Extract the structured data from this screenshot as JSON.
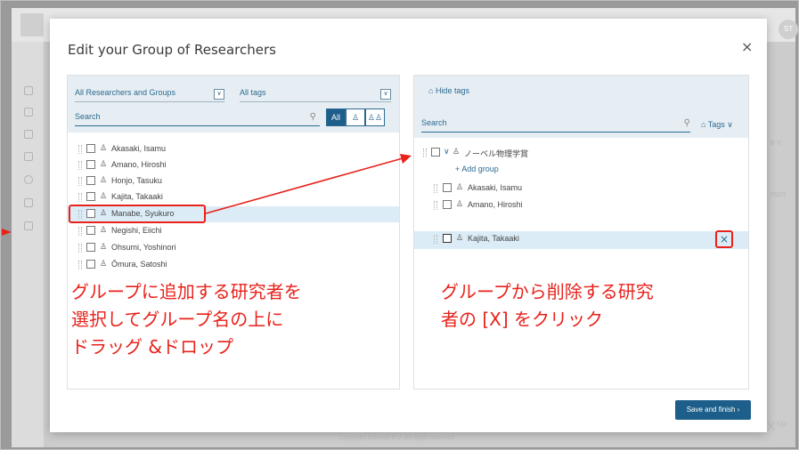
{
  "background": {
    "avatar_initials": "ST",
    "right_hint_1": "e v",
    "right_hint_2": "rsch",
    "footer": "Copyright Elsevier B.V. All rights reserved.",
    "elx": "LX™"
  },
  "modal": {
    "title": "Edit your Group of Researchers",
    "close_label": "×",
    "save_label": "Save and finish  ›"
  },
  "left_panel": {
    "filter_researchers": "All Researchers and Groups",
    "filter_tags": "All tags",
    "search_placeholder": "Search",
    "segments": [
      "All",
      "♙",
      "♙♙"
    ],
    "rows": [
      {
        "name": "Akasaki, Isamu"
      },
      {
        "name": "Amano, Hiroshi"
      },
      {
        "name": "Honjo, Tasuku"
      },
      {
        "name": "Kajita, Takaaki"
      },
      {
        "name": "Manabe, Syukuro"
      },
      {
        "name": "Negishi, Eiichi"
      },
      {
        "name": "Ohsumi, Yoshinori"
      },
      {
        "name": "Ōmura, Satoshi"
      }
    ]
  },
  "right_panel": {
    "hide_tags": "Hide tags",
    "search_placeholder": "Search",
    "tags_label": "Tags ∨",
    "group_name": "ノーベル物理学賞",
    "add_group": "+ Add group",
    "members": [
      {
        "name": "Akasaki, Isamu"
      },
      {
        "name": "Amano, Hiroshi"
      },
      {
        "name": "Kajita, Takaaki"
      }
    ],
    "remove_label": "×"
  },
  "annotations": {
    "left": [
      "グループに追加する研究者を",
      "選択してグループ名の上に",
      "ドラッグ &ドロップ"
    ],
    "right": [
      "グループから削除する研究",
      "者の [X] をクリック"
    ]
  },
  "colors": {
    "accent": "#1d5f8a",
    "annotation": "#e8221b",
    "selected_row": "#dcecf7"
  }
}
